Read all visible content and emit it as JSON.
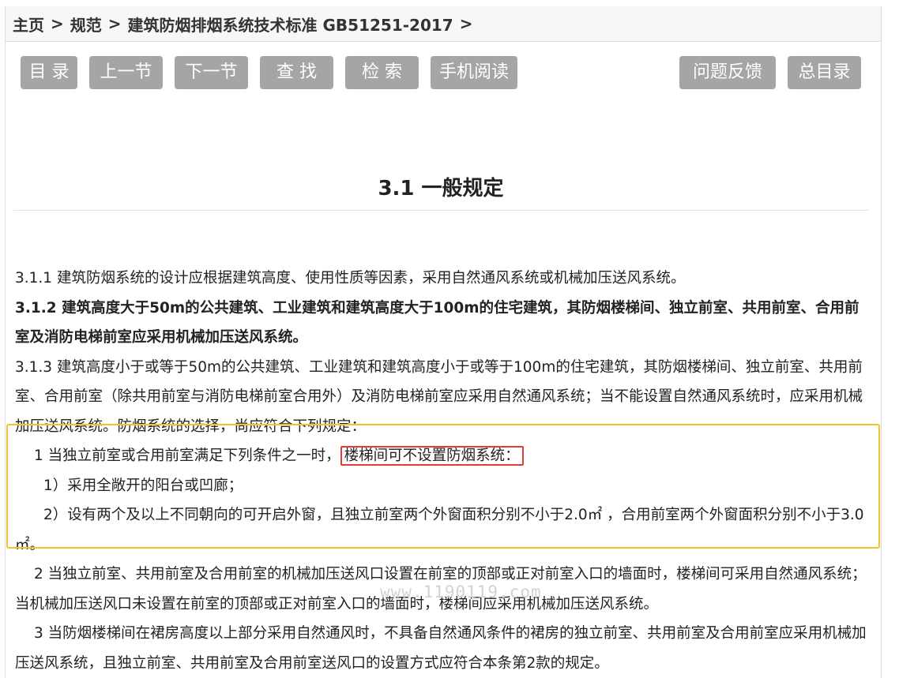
{
  "breadcrumb": {
    "home": "主页",
    "spec": "规范",
    "standard": "建筑防烟排烟系统技术标准 GB51251-2017",
    "separator": ">"
  },
  "toolbar": {
    "contents": "目 录",
    "prev": "上一节",
    "next": "下一节",
    "find": "查 找",
    "search": "检 索",
    "mobile": "手机阅读",
    "feedback": "问题反馈",
    "master_index": "总目录"
  },
  "section": {
    "title": "3.1  一般规定"
  },
  "content": {
    "p311": "3.1.1 建筑防烟系统的设计应根据建筑高度、使用性质等因素，采用自然通风系统或机械加压送风系统。",
    "p312": "3.1.2 建筑高度大于50m的公共建筑、工业建筑和建筑高度大于100m的住宅建筑，其防烟楼梯间、独立前室、共用前室、合用前室及消防电梯前室应采用机械加压送风系统。",
    "p313": "3.1.3 建筑高度小于或等于50m的公共建筑、工业建筑和建筑高度小于或等于100m的住宅建筑，其防烟楼梯间、独立前室、共用前室、合用前室（除共用前室与消防电梯前室合用外）及消防电梯前室应采用自然通风系统；当不能设置自然通风系统时，应采用机械加压送风系统。防烟系统的选择，尚应符合下列规定：",
    "item1_prefix": "1 当独立前室或合用前室满足下列条件之一时，",
    "item1_highlight": "楼梯间可不设置防烟系统：",
    "item1_1": "1）采用全敞开的阳台或凹廊；",
    "item1_2": "2）设有两个及以上不同朝向的可开启外窗，且独立前室两个外窗面积分别不小于2.0㎡ ，合用前室两个外窗面积分别不小于3.0㎡。",
    "item2": "2 当独立前室、共用前室及合用前室的机械加压送风口设置在前室的顶部或正对前室入口的墙面时，楼梯间可采用自然通风系统；当机械加压送风口未设置在前室的顶部或正对前室入口的墙面时，楼梯间应采用机械加压送风系统。",
    "item3": "3 当防烟楼梯间在裙房高度以上部分采用自然通风时，不具备自然通风条件的裙房的独立前室、共用前室及合用前室应采用机械加压送风系统，且独立前室、共用前室及合用前室送风口的设置方式应符合本条第2款的规定。"
  },
  "watermark": "www.1190119.com",
  "colors": {
    "button_bg": "#a5a5a5",
    "highlight_yellow": "#f2c230",
    "highlight_red": "#e23b3b"
  }
}
